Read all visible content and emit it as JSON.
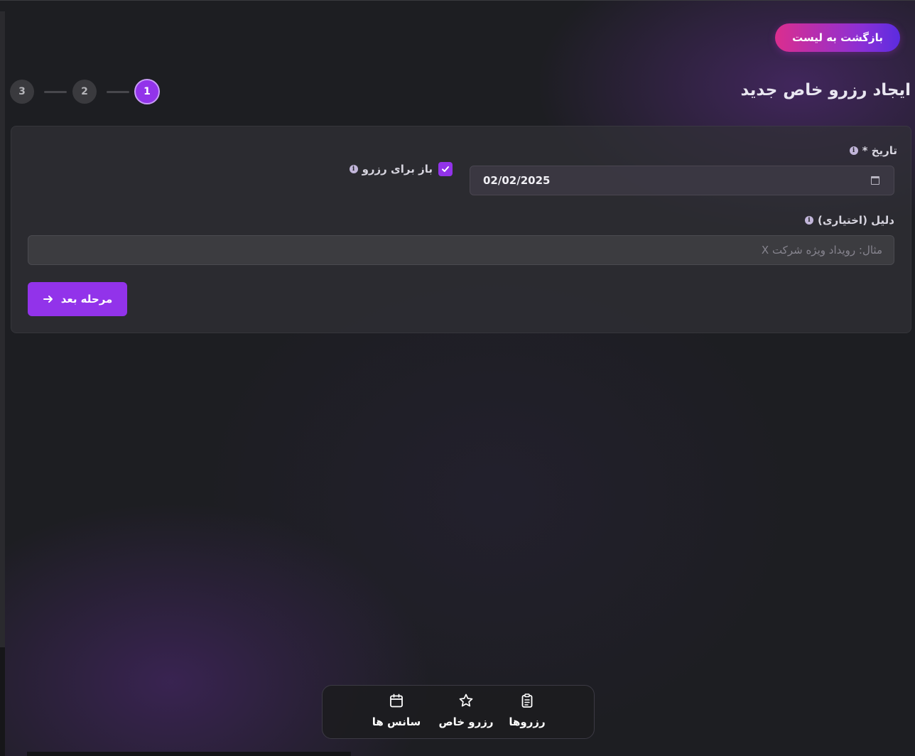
{
  "header": {
    "back_button_label": "بازگشت به لیست",
    "title": "ایجاد رزرو خاص جدید"
  },
  "stepper": {
    "steps": [
      "3",
      "2",
      "1"
    ],
    "active_step": "1"
  },
  "form": {
    "date_label": "تاریخ *",
    "date_value": "02/02/2025",
    "open_for_booking_label": "باز برای رزرو",
    "open_for_booking_checked": true,
    "reason_label": "دلیل (اختیاری)",
    "reason_placeholder": "مثال: رویداد ویژه شرکت X",
    "reason_value": "",
    "next_button_label": "مرحله بعد"
  },
  "bottom_nav": {
    "items": [
      {
        "label": "سانس ها",
        "icon": "calendar-icon"
      },
      {
        "label": "رزرو خاص",
        "icon": "star-icon"
      },
      {
        "label": "رزروها",
        "icon": "clipboard-icon"
      }
    ]
  },
  "colors": {
    "accent": "#9233ea",
    "background": "#1d1e22",
    "back_button_gradient_start": "#db2e8e",
    "back_button_gradient_end": "#5b2ce0"
  }
}
